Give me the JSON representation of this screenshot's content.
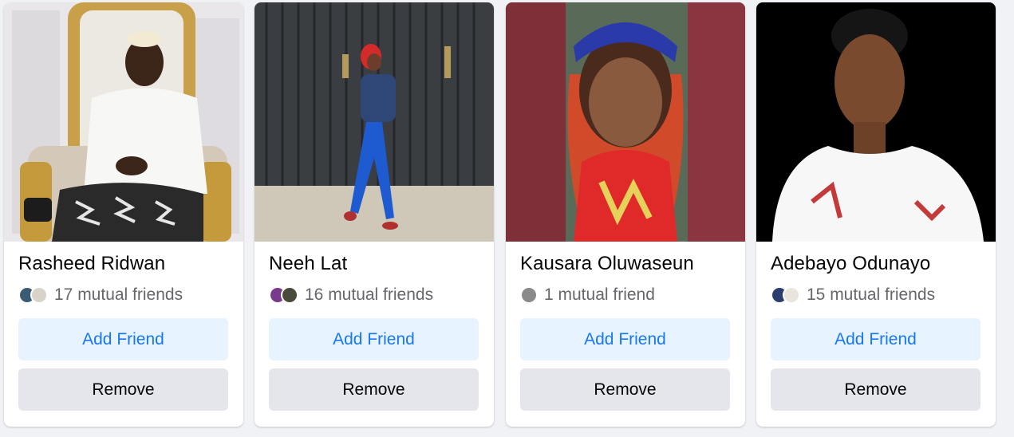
{
  "suggestions": [
    {
      "name": "Rasheed Ridwan",
      "mutual": "17 mutual friends",
      "add_label": "Add Friend",
      "remove_label": "Remove",
      "avatar_colors": [
        "#3b5a73",
        "#d8d2c8"
      ]
    },
    {
      "name": "Neeh Lat",
      "mutual": "16 mutual friends",
      "add_label": "Add Friend",
      "remove_label": "Remove",
      "avatar_colors": [
        "#7a3a8c",
        "#4a4a3a"
      ]
    },
    {
      "name": "Kausara Oluwaseun",
      "mutual": "1 mutual friend",
      "add_label": "Add Friend",
      "remove_label": "Remove",
      "avatar_colors": [
        "#8a8a8a"
      ]
    },
    {
      "name": "Adebayo Odunayo",
      "mutual": "15 mutual friends",
      "add_label": "Add Friend",
      "remove_label": "Remove",
      "avatar_colors": [
        "#2c3e6b",
        "#e9e4dc"
      ]
    }
  ],
  "colors": {
    "add_bg": "#e7f3ff",
    "add_text": "#1877f2",
    "remove_bg": "#e4e6eb",
    "page_bg": "#f0f2f5"
  }
}
